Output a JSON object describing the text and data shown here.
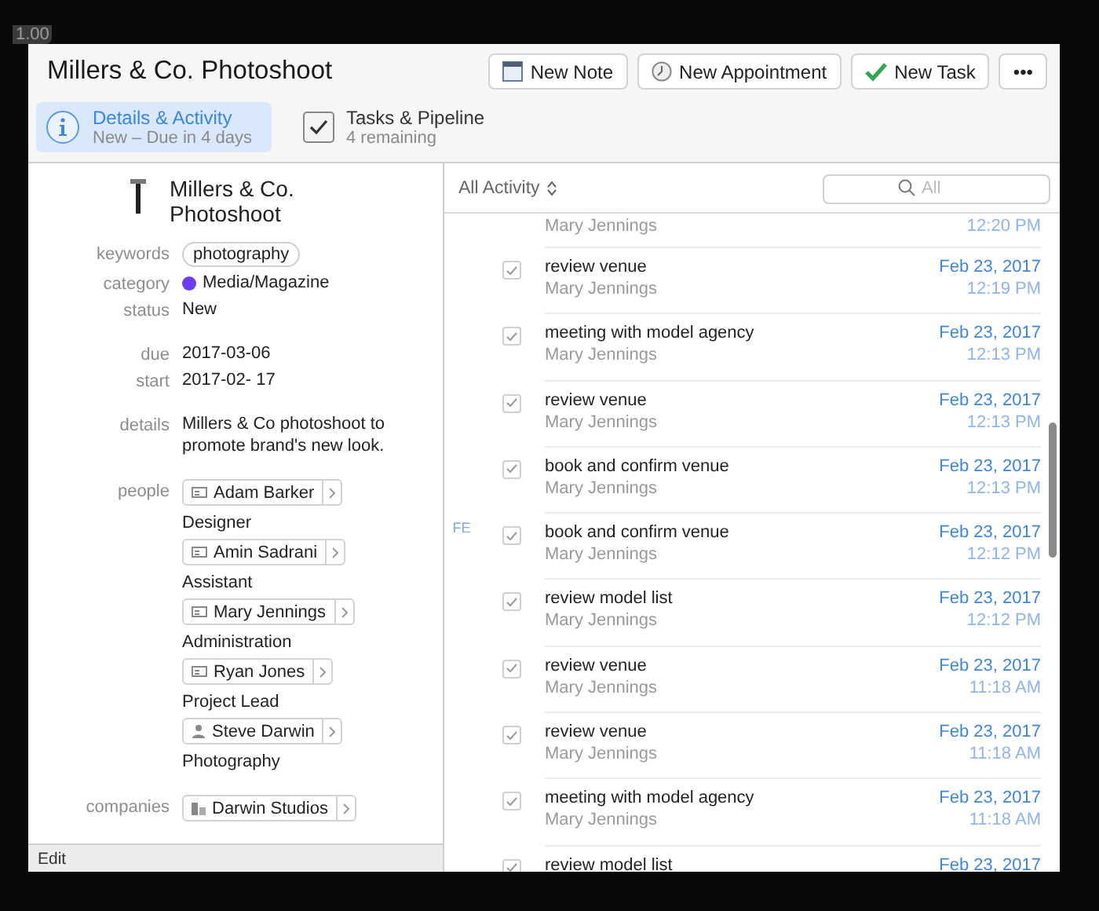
{
  "overlay_label": "1.00",
  "window": {
    "title": "Millers & Co. Photoshoot"
  },
  "toolbar_buttons": [
    {
      "kind": "note",
      "label": "New Note"
    },
    {
      "kind": "appointment",
      "label": "New Appointment"
    },
    {
      "kind": "task",
      "label": "New Task"
    },
    {
      "kind": "more",
      "label": "•••"
    }
  ],
  "tabs": [
    {
      "kind": "info",
      "title": "Details & Activity",
      "subtitle": "New – Due in 4 days",
      "selected": true
    },
    {
      "kind": "check",
      "title": "Tasks & Pipeline",
      "subtitle": "4 remaining",
      "selected": false
    }
  ],
  "details": {
    "title": "Millers & Co. Photoshoot",
    "field_groups": [
      [
        {
          "kind": "tag",
          "label": "keywords",
          "value": "photography"
        },
        {
          "kind": "category",
          "label": "category",
          "value": "Media/Magazine",
          "color": "#6b3cf2"
        },
        {
          "kind": "text",
          "label": "status",
          "value": "New"
        }
      ],
      [
        {
          "kind": "text",
          "label": "due",
          "value": "2017-03-06"
        },
        {
          "kind": "text",
          "label": "start",
          "value": "2017-02- 17"
        }
      ],
      [
        {
          "kind": "text",
          "label": "details",
          "value": "Millers & Co photoshoot to promote brand's new look."
        }
      ]
    ],
    "people": {
      "label": "people",
      "items": [
        {
          "kind": "card",
          "name": "Adam Barker",
          "role": "Designer"
        },
        {
          "kind": "card",
          "name": "Amin Sadrani",
          "role": "Assistant"
        },
        {
          "kind": "card",
          "name": "Mary Jennings",
          "role": "Administration"
        },
        {
          "kind": "card",
          "name": "Ryan Jones",
          "role": "Project Lead"
        },
        {
          "kind": "person",
          "name": "Steve Darwin",
          "role": "Photography"
        }
      ]
    },
    "companies": {
      "label": "companies",
      "items": [
        {
          "name": "Darwin Studios"
        }
      ]
    },
    "footer": "Edit"
  },
  "activity": {
    "filter": "All Activity",
    "search": {
      "placeholder": "All"
    },
    "gutter_label": "FE",
    "items": [
      {
        "person": "Mary Jennings",
        "time": "12:20 PM"
      },
      {
        "title": "review venue",
        "person": "Mary Jennings",
        "date": "Feb 23, 2017",
        "time": "12:19 PM",
        "checked": true
      },
      {
        "title": "meeting with model agency",
        "person": "Mary Jennings",
        "date": "Feb 23, 2017",
        "time": "12:13 PM",
        "checked": true
      },
      {
        "title": "review venue",
        "person": "Mary Jennings",
        "date": "Feb 23, 2017",
        "time": "12:13 PM",
        "checked": true
      },
      {
        "title": "book and confirm venue",
        "person": "Mary Jennings",
        "date": "Feb 23, 2017",
        "time": "12:13 PM",
        "checked": true
      },
      {
        "title": "book and confirm venue",
        "person": "Mary Jennings",
        "date": "Feb 23, 2017",
        "time": "12:12 PM",
        "checked": true
      },
      {
        "title": "review model list",
        "person": "Mary Jennings",
        "date": "Feb 23, 2017",
        "time": "12:12 PM",
        "checked": true
      },
      {
        "title": "review venue",
        "person": "Mary Jennings",
        "date": "Feb 23, 2017",
        "time": "11:18 AM",
        "checked": true
      },
      {
        "title": "review venue",
        "person": "Mary Jennings",
        "date": "Feb 23, 2017",
        "time": "11:18 AM",
        "checked": true
      },
      {
        "title": "meeting with model agency",
        "person": "Mary Jennings",
        "date": "Feb 23, 2017",
        "time": "11:18 AM",
        "checked": true
      },
      {
        "title": "review model list",
        "date": "Feb 23, 2017",
        "checked": true
      }
    ]
  }
}
